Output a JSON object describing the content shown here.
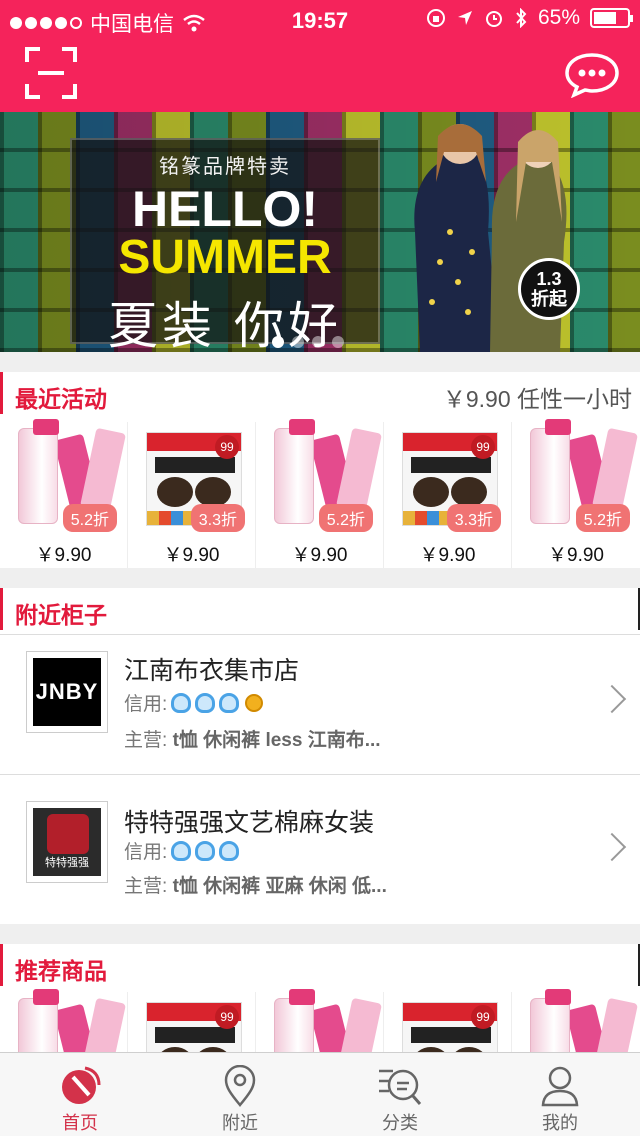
{
  "status_bar": {
    "carrier": "中国电信",
    "time": "19:57",
    "battery": "65%",
    "battery_level": 0.65,
    "signal_bars": 4
  },
  "header": {
    "scan_icon": "scan-icon",
    "message_icon": "message-bubble-icon",
    "accent_color": "#f5235b"
  },
  "banner": {
    "brand": "铭篆品牌特卖",
    "headline": "HELLO!",
    "subheadline": "SUMMER",
    "cn_text": "夏装 你好",
    "badge_top": "1.3",
    "badge_bottom": "折起",
    "page_count": 4,
    "active_page": 1
  },
  "recent": {
    "title": "最近活动",
    "extra": "￥9.90 任性一小时",
    "products": [
      {
        "type": "cream",
        "discount": "5.2折",
        "price": "￥9.90"
      },
      {
        "type": "cookie",
        "discount": "3.3折",
        "price": "￥9.90"
      },
      {
        "type": "cream",
        "discount": "5.2折",
        "price": "￥9.90"
      },
      {
        "type": "cookie",
        "discount": "3.3折",
        "price": "￥9.90"
      },
      {
        "type": "cream",
        "discount": "5.2折",
        "price": "￥9.90"
      }
    ]
  },
  "nearby": {
    "title": "附近柜子",
    "stores": [
      {
        "name": "江南布衣集市店",
        "logo_text": "JNBY",
        "credit_label": "信用:",
        "crowns": 3,
        "medal": true,
        "main_label": "主营:",
        "main_items": "t恤 休闲裤 less 江南布..."
      },
      {
        "name": "特特强强文艺棉麻女装",
        "logo_text": "特特强强",
        "credit_label": "信用:",
        "crowns": 3,
        "medal": false,
        "main_label": "主营:",
        "main_items": "t恤 休闲裤 亚麻 休闲 低..."
      }
    ]
  },
  "recommend": {
    "title": "推荐商品"
  },
  "tabbar": {
    "tabs": [
      {
        "label": "首页",
        "icon": "home-radar-icon",
        "active": true
      },
      {
        "label": "附近",
        "icon": "location-pin-icon",
        "active": false
      },
      {
        "label": "分类",
        "icon": "category-search-icon",
        "active": false
      },
      {
        "label": "我的",
        "icon": "user-icon",
        "active": false
      }
    ]
  }
}
